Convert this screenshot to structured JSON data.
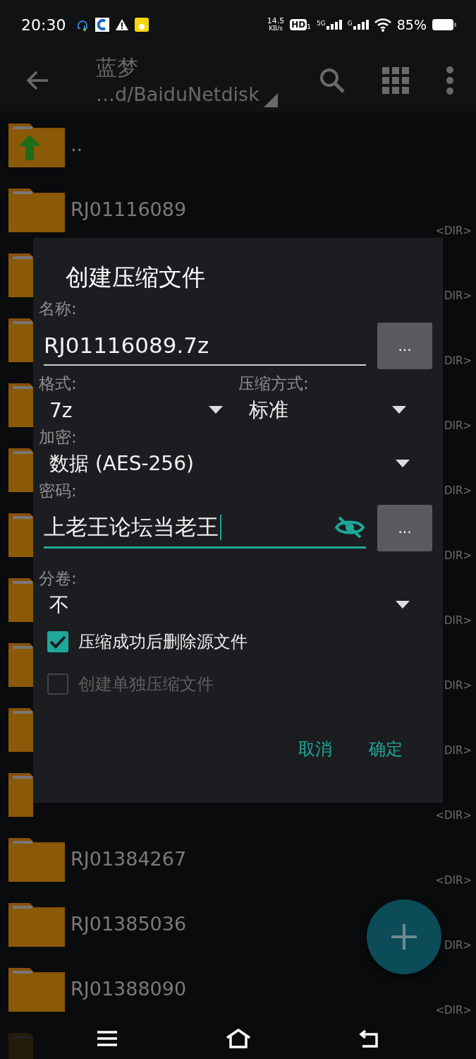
{
  "status_bar": {
    "time": "20:30",
    "net_speed": "14.5",
    "net_unit": "KB/s",
    "hd": "HD",
    "hd_sub": "1",
    "sim1": "5G",
    "sim2": "G",
    "battery": "85%"
  },
  "app_bar": {
    "title": "蓝梦",
    "path": "…d/BaiduNetdisk"
  },
  "files": [
    {
      "kind": "up",
      "name": ".."
    },
    {
      "kind": "dir",
      "name": "RJ01116089",
      "dir": "<DIR>"
    },
    {
      "kind": "dir",
      "dir": "DIR>"
    },
    {
      "kind": "dir",
      "dir": "DIR>"
    },
    {
      "kind": "dir",
      "dir": "DIR>"
    },
    {
      "kind": "dir",
      "dir": "DIR>"
    },
    {
      "kind": "dir",
      "dir": "DIR>"
    },
    {
      "kind": "dir",
      "dir": "DIR>"
    },
    {
      "kind": "dir",
      "dir": "DIR>"
    },
    {
      "kind": "dir",
      "dir": "DIR>"
    },
    {
      "kind": "dir",
      "dir": "<DIR>"
    },
    {
      "kind": "dir",
      "name": "RJ01384267",
      "dir": "<DIR>"
    },
    {
      "kind": "dir",
      "name": "RJ01385036",
      "dir": "DIR>"
    },
    {
      "kind": "dir",
      "name": "RJ01388090",
      "dir": "<DIR>"
    },
    {
      "kind": "dir"
    }
  ],
  "dialog": {
    "title": "创建压缩文件",
    "name_label": "名称:",
    "name_value": "RJ01116089.7z",
    "name_focused": false,
    "browse_button": "...",
    "format_label": "格式:",
    "format_value": "7z",
    "method_label": "压缩方式:",
    "method_value": "标准",
    "encryption_label": "加密:",
    "encryption_value": "数据 (AES-256)",
    "password_label": "密码:",
    "password_value": "上老王论坛当老王",
    "password_focused": true,
    "password_visible": true,
    "password_button": "...",
    "split_label": "分卷:",
    "split_value": "不",
    "options": [
      {
        "label": "压缩成功后删除源文件",
        "checked": true,
        "disabled": false
      },
      {
        "label": "创建单独压缩文件",
        "checked": false,
        "disabled": true
      }
    ],
    "buttons": [
      "取消",
      "确定"
    ]
  }
}
